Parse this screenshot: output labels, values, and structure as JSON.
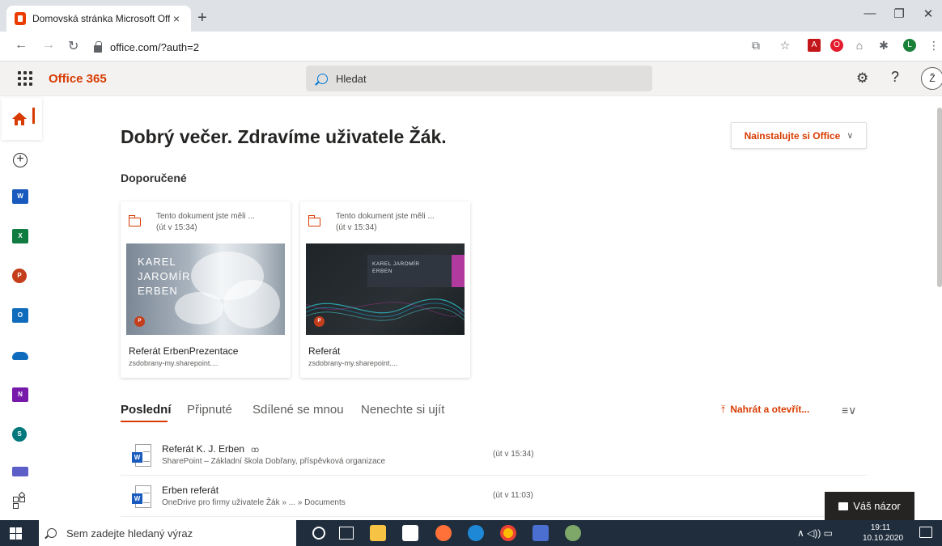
{
  "browser": {
    "tab_title": "Domovská stránka Microsoft Offi",
    "tab_close": "×",
    "new_tab": "+",
    "url": "office.com/?auth=2",
    "profile_initial": "L"
  },
  "office_header": {
    "brand": "Office 365",
    "search_placeholder": "Hledat",
    "help": "?",
    "avatar_initial": "Ž"
  },
  "rail": {
    "apps": [
      {
        "name": "word",
        "letter": "W",
        "color": "#185abd"
      },
      {
        "name": "excel",
        "letter": "X",
        "color": "#107c41"
      },
      {
        "name": "powerpoint",
        "letter": "P",
        "color": "#c43e1c"
      },
      {
        "name": "outlook",
        "letter": "O",
        "color": "#0f6cbd"
      },
      {
        "name": "onedrive",
        "letter": "",
        "color": "#0f6cbd"
      },
      {
        "name": "onenote",
        "letter": "N",
        "color": "#7719aa"
      },
      {
        "name": "sharepoint",
        "letter": "S",
        "color": "#03787c"
      },
      {
        "name": "teams",
        "letter": "",
        "color": "#5b5fc7"
      }
    ]
  },
  "main": {
    "greeting": "Dobrý večer. Zdravíme uživatele Žák.",
    "install_button": "Nainstalujte si Office",
    "recommended_heading": "Doporučené",
    "cards": [
      {
        "reason_line1": "Tento dokument jste měli ...",
        "reason_line2": "(út v 15:34)",
        "thumb_title": [
          "KAREL",
          "JAROMÍR",
          "ERBEN"
        ],
        "name": "Referát ErbenPrezentace",
        "location": "zsdobrany-my.sharepoint...."
      },
      {
        "reason_line1": "Tento dokument jste měli ...",
        "reason_line2": "(út v 15:34)",
        "thumb_title": [
          "KAREL JAROMÍR",
          "ERBEN"
        ],
        "name": "Referát",
        "location": "zsdobrany-my.sharepoint...."
      }
    ],
    "tabs": [
      "Poslední",
      "Připnuté",
      "Sdílené se mnou",
      "Nenechte si ujít"
    ],
    "upload_label": "Nahrát a otevřít...",
    "files": [
      {
        "name": "Referát K. J. Erben",
        "location": "SharePoint – Základní škola Dobřany, příspěvková organizace",
        "date": "(út v 15:34)"
      },
      {
        "name": "Erben referát",
        "location": "OneDrive pro firmy uživatele Žák » ... » Documents",
        "date": "(út v 11:03)"
      }
    ],
    "feedback_label": "Váš názor"
  },
  "taskbar": {
    "search_placeholder": "Sem zadejte hledaný výraz",
    "time": "19:11",
    "date": "10.10.2020"
  }
}
